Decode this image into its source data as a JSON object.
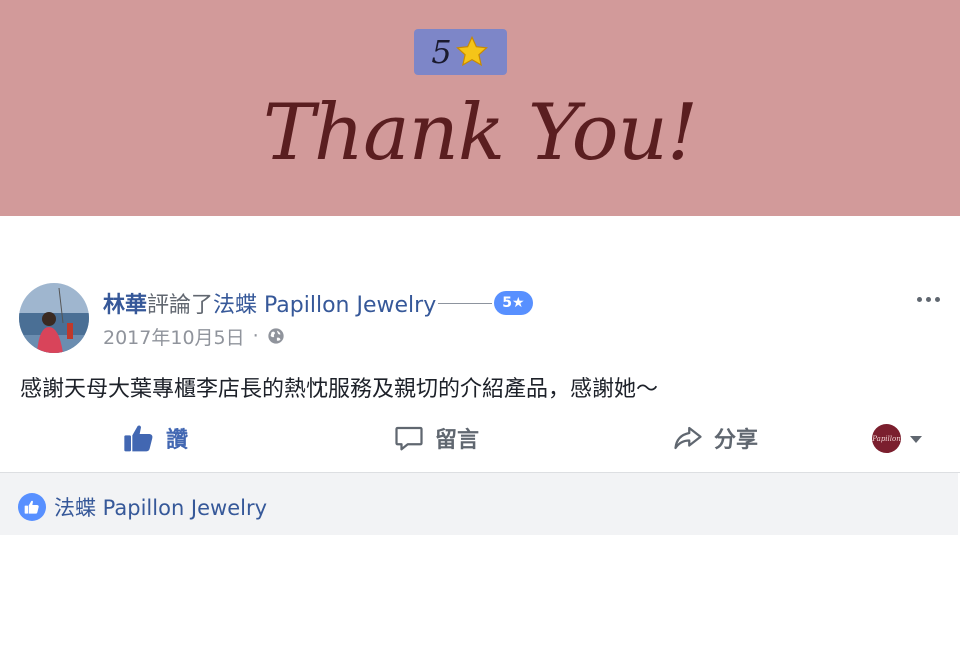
{
  "banner": {
    "rating_value": "5",
    "rating_icon": "star-icon",
    "thank_you_text": "Thank You!",
    "background_color": "#d29a9a",
    "text_color": "#5a1e20"
  },
  "post": {
    "author_name": "林華",
    "action_text": "評論了",
    "page_name": "法蝶 Papillon Jewelry",
    "rating_badge": "5★",
    "date": "2017年10月5日",
    "separator": "·",
    "privacy_icon": "globe-icon",
    "more_icon": "more-options-icon",
    "body": "感謝天母大葉專櫃李店長的熱忱服務及親切的介紹產品，感謝她～"
  },
  "actions": {
    "like_label": "讚",
    "comment_label": "留言",
    "share_label": "分享"
  },
  "switcher": {
    "avatar_text": "Papillon",
    "icon": "chevron-down-icon"
  },
  "likes": {
    "liker_name": "法蝶 Papillon Jewelry"
  },
  "colors": {
    "link": "#365899",
    "like_blue": "#4267b2",
    "badge_blue": "#5890ff",
    "muted": "#90949c"
  }
}
